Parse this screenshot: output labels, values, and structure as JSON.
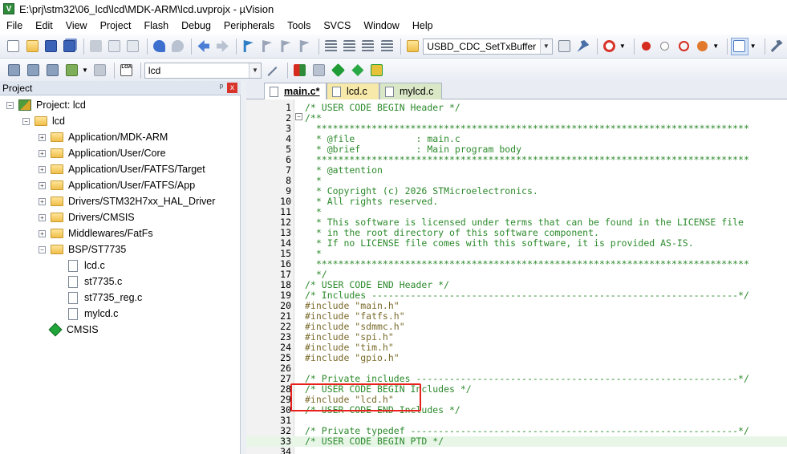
{
  "window": {
    "title": "E:\\prj\\stm32\\06_lcd\\lcd\\MDK-ARM\\lcd.uvprojx - µVision",
    "app_icon_letter": "V"
  },
  "menu": [
    "File",
    "Edit",
    "View",
    "Project",
    "Flash",
    "Debug",
    "Peripherals",
    "Tools",
    "SVCS",
    "Window",
    "Help"
  ],
  "toolbar": {
    "find_combo_value": "USBD_CDC_SetTxBuffer",
    "target_combo_value": "lcd",
    "load_label": "LOAD"
  },
  "project_panel": {
    "title": "Project",
    "pin_glyph": "ᵖ",
    "close_glyph": "x",
    "root": "Project: lcd",
    "target": "lcd",
    "groups": [
      "Application/MDK-ARM",
      "Application/User/Core",
      "Application/User/FATFS/Target",
      "Application/User/FATFS/App",
      "Drivers/STM32H7xx_HAL_Driver",
      "Drivers/CMSIS",
      "Middlewares/FatFs",
      "BSP/ST7735"
    ],
    "bsp_files": [
      "lcd.c",
      "st7735.c",
      "st7735_reg.c",
      "mylcd.c"
    ],
    "cmsis": "CMSIS"
  },
  "tabs": [
    "main.c*",
    "lcd.c",
    "mylcd.c"
  ],
  "editor": {
    "lines": [
      {
        "n": "1",
        "t": "/* USER CODE BEGIN Header */",
        "k": "comment"
      },
      {
        "n": "2",
        "t": "/**",
        "k": "comment"
      },
      {
        "n": "3",
        "t": "  ******************************************************************************",
        "k": "comment"
      },
      {
        "n": "4",
        "t": "  * @file           : main.c",
        "k": "comment"
      },
      {
        "n": "5",
        "t": "  * @brief          : Main program body",
        "k": "comment"
      },
      {
        "n": "6",
        "t": "  ******************************************************************************",
        "k": "comment"
      },
      {
        "n": "7",
        "t": "  * @attention",
        "k": "comment"
      },
      {
        "n": "8",
        "t": "  *",
        "k": "comment"
      },
      {
        "n": "9",
        "t": "  * Copyright (c) 2026 STMicroelectronics.",
        "k": "comment"
      },
      {
        "n": "10",
        "t": "  * All rights reserved.",
        "k": "comment"
      },
      {
        "n": "11",
        "t": "  *",
        "k": "comment"
      },
      {
        "n": "12",
        "t": "  * This software is licensed under terms that can be found in the LICENSE file",
        "k": "comment"
      },
      {
        "n": "13",
        "t": "  * in the root directory of this software component.",
        "k": "comment"
      },
      {
        "n": "14",
        "t": "  * If no LICENSE file comes with this software, it is provided AS-IS.",
        "k": "comment"
      },
      {
        "n": "15",
        "t": "  *",
        "k": "comment"
      },
      {
        "n": "16",
        "t": "  ******************************************************************************",
        "k": "comment"
      },
      {
        "n": "17",
        "t": "  */",
        "k": "comment"
      },
      {
        "n": "18",
        "t": "/* USER CODE END Header */",
        "k": "comment"
      },
      {
        "n": "19",
        "t": "/* Includes ------------------------------------------------------------------*/",
        "k": "comment"
      },
      {
        "n": "20",
        "t": "#include \"main.h\"",
        "k": "pre"
      },
      {
        "n": "21",
        "t": "#include \"fatfs.h\"",
        "k": "pre"
      },
      {
        "n": "22",
        "t": "#include \"sdmmc.h\"",
        "k": "pre"
      },
      {
        "n": "23",
        "t": "#include \"spi.h\"",
        "k": "pre"
      },
      {
        "n": "24",
        "t": "#include \"tim.h\"",
        "k": "pre"
      },
      {
        "n": "25",
        "t": "#include \"gpio.h\"",
        "k": "pre"
      },
      {
        "n": "26",
        "t": "",
        "k": "plain"
      },
      {
        "n": "27",
        "t": "/* Private includes ----------------------------------------------------------*/",
        "k": "comment"
      },
      {
        "n": "28",
        "t": "/* USER CODE BEGIN Includes */",
        "k": "comment"
      },
      {
        "n": "29",
        "t": "#include \"lcd.h\"",
        "k": "pre"
      },
      {
        "n": "30",
        "t": "/* USER CODE END Includes */",
        "k": "comment"
      },
      {
        "n": "31",
        "t": "",
        "k": "plain"
      },
      {
        "n": "32",
        "t": "/* Private typedef -----------------------------------------------------------*/",
        "k": "comment"
      },
      {
        "n": "33",
        "t": "/* USER CODE BEGIN PTD */",
        "k": "comment"
      },
      {
        "n": "34",
        "t": "",
        "k": "plain"
      }
    ],
    "fold_marks": [
      "−",
      "−"
    ]
  }
}
